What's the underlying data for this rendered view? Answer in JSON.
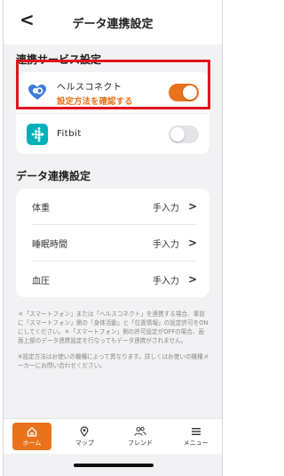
{
  "header": {
    "back_label": "<",
    "title": "データ連携設定"
  },
  "services": {
    "section_title": "連携サービス設定",
    "items": [
      {
        "name": "ヘルスコネクト",
        "link": "設定方法を確認する",
        "icon": "health-connect-icon",
        "enabled": true,
        "highlighted": true
      },
      {
        "name": "Fitbit",
        "icon": "fitbit-icon",
        "enabled": false
      }
    ]
  },
  "data_settings": {
    "section_title": "データ連携設定",
    "rows": [
      {
        "label": "体重",
        "value": "手入力",
        "chevron": ">"
      },
      {
        "label": "睡眠時間",
        "value": "手入力",
        "chevron": ">"
      },
      {
        "label": "血圧",
        "value": "手入力",
        "chevron": ">"
      }
    ]
  },
  "notes": [
    "＊「スマートフォン」または「ヘルスコネクト」を連携する場合、事前に「スマートフォン」側の「身体活動」と「位置情報」の設定許可をONにしてください。＊「スマートフォン」側の許可設定がOFFの場合、画面上部のデータ連携設定を行なってもデータ連携がされません。",
    "※設定方法はお使いの機種によって異なります。詳しくはお使いの機種メーカーにお問い合わせください。"
  ],
  "tabbar": {
    "items": [
      {
        "label": "ホーム",
        "icon": "home-icon",
        "active": true
      },
      {
        "label": "マップ",
        "icon": "map-pin-icon",
        "active": false
      },
      {
        "label": "フレンド",
        "icon": "friends-icon",
        "active": false
      },
      {
        "label": "メニュー",
        "icon": "menu-icon",
        "active": false
      }
    ]
  },
  "colors": {
    "accent": "#e8731c",
    "highlight": "#e0141e",
    "background": "#f2f2f4"
  }
}
